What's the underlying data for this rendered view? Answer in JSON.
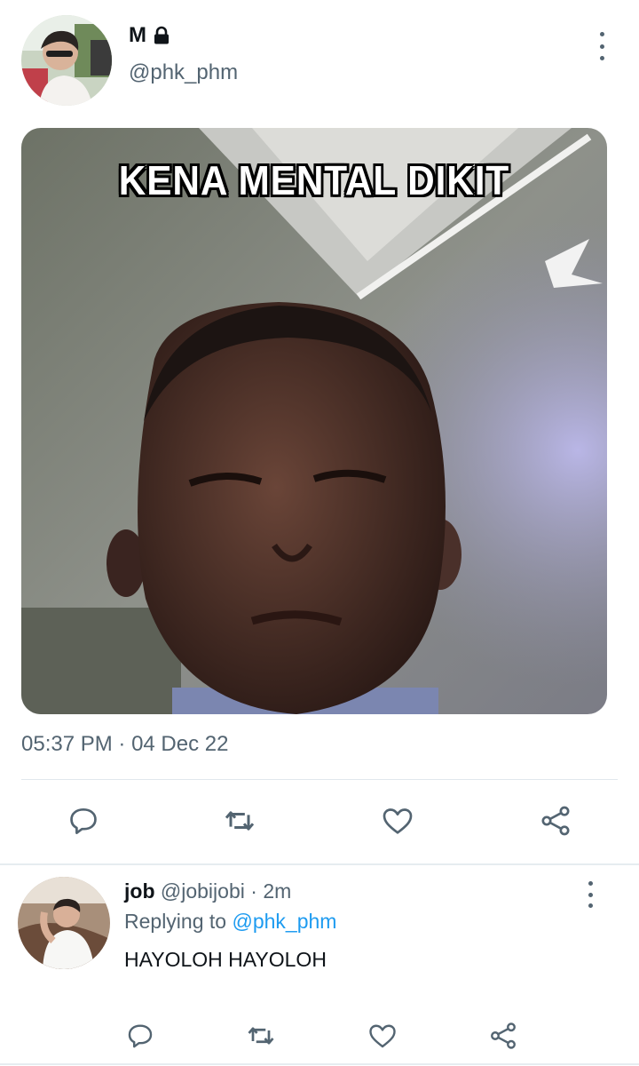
{
  "tweet": {
    "author": {
      "name": "M",
      "handle": "@phk_phm",
      "locked": true
    },
    "media_caption": "KENA MENTAL DIKIT",
    "time": "05:37 PM",
    "separator": " · ",
    "date": "04 Dec 22",
    "actions": [
      "reply",
      "retweet",
      "like",
      "share"
    ]
  },
  "reply": {
    "author": {
      "name": "job",
      "handle": "@jobijobi"
    },
    "separator": " · ",
    "age": "2m",
    "replying_prefix": "Replying to ",
    "replying_to": "@phk_phm",
    "text": "HAYOLOH HAYOLOH",
    "actions": [
      "reply",
      "retweet",
      "like",
      "share"
    ]
  },
  "colors": {
    "text": "#0f1419",
    "secondary": "#536471",
    "link": "#1d9bf0",
    "divider": "#e1e8ed"
  }
}
